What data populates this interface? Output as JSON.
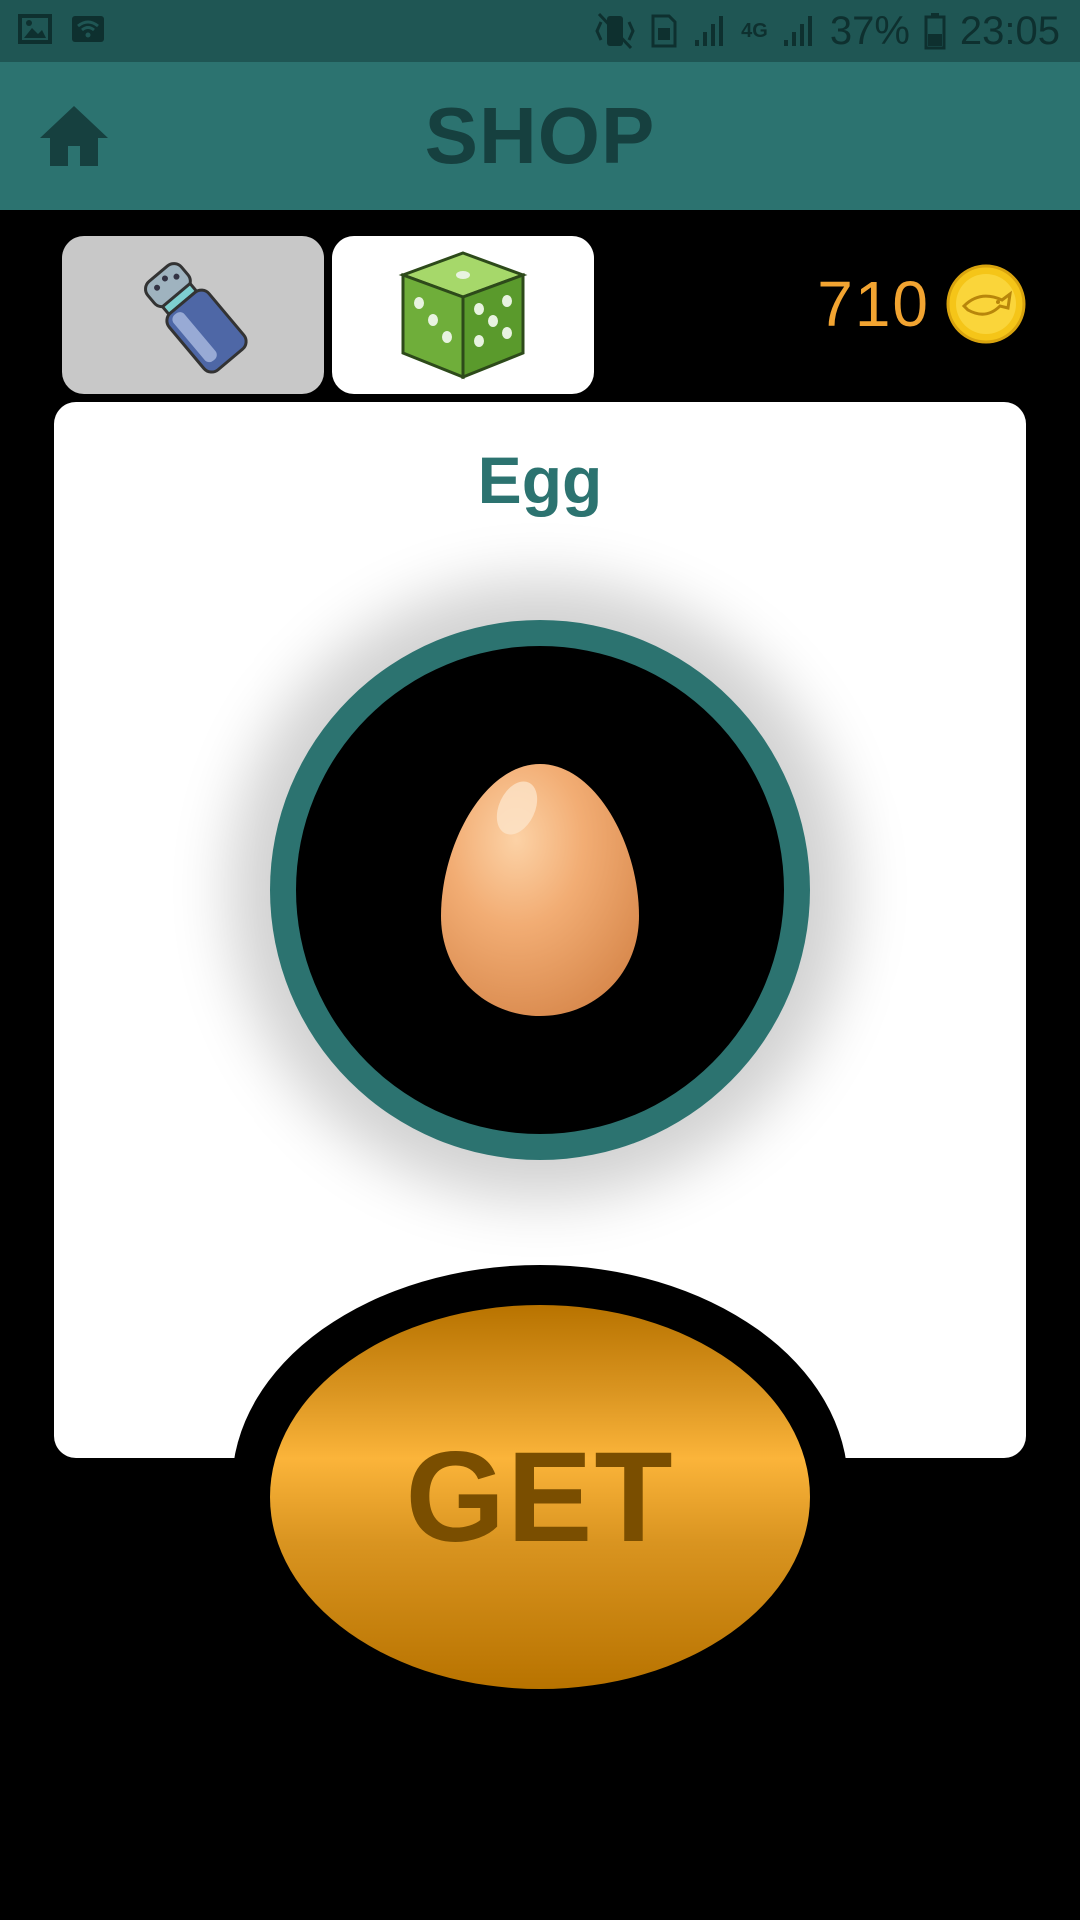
{
  "status_bar": {
    "battery": "37%",
    "time": "23:05",
    "network": "4G",
    "icons": [
      "image-icon",
      "wifi-icon",
      "vibrate-icon",
      "sim-icon",
      "signal-icon",
      "battery-icon"
    ]
  },
  "app_bar": {
    "title": "SHOP",
    "home_icon": "home-icon"
  },
  "tabs": [
    {
      "icon": "salt-shaker-icon",
      "selected": false
    },
    {
      "icon": "dice-icon",
      "selected": true
    }
  ],
  "coins": {
    "count": "710",
    "icon": "coin-icon"
  },
  "item": {
    "name": "Egg",
    "icon": "egg-icon"
  },
  "get_button": {
    "label": "GET"
  },
  "colors": {
    "primary": "#2c7370",
    "status_bar": "#1f5654",
    "coin_text": "#f2a431",
    "button_gold": "#fbb43a"
  }
}
